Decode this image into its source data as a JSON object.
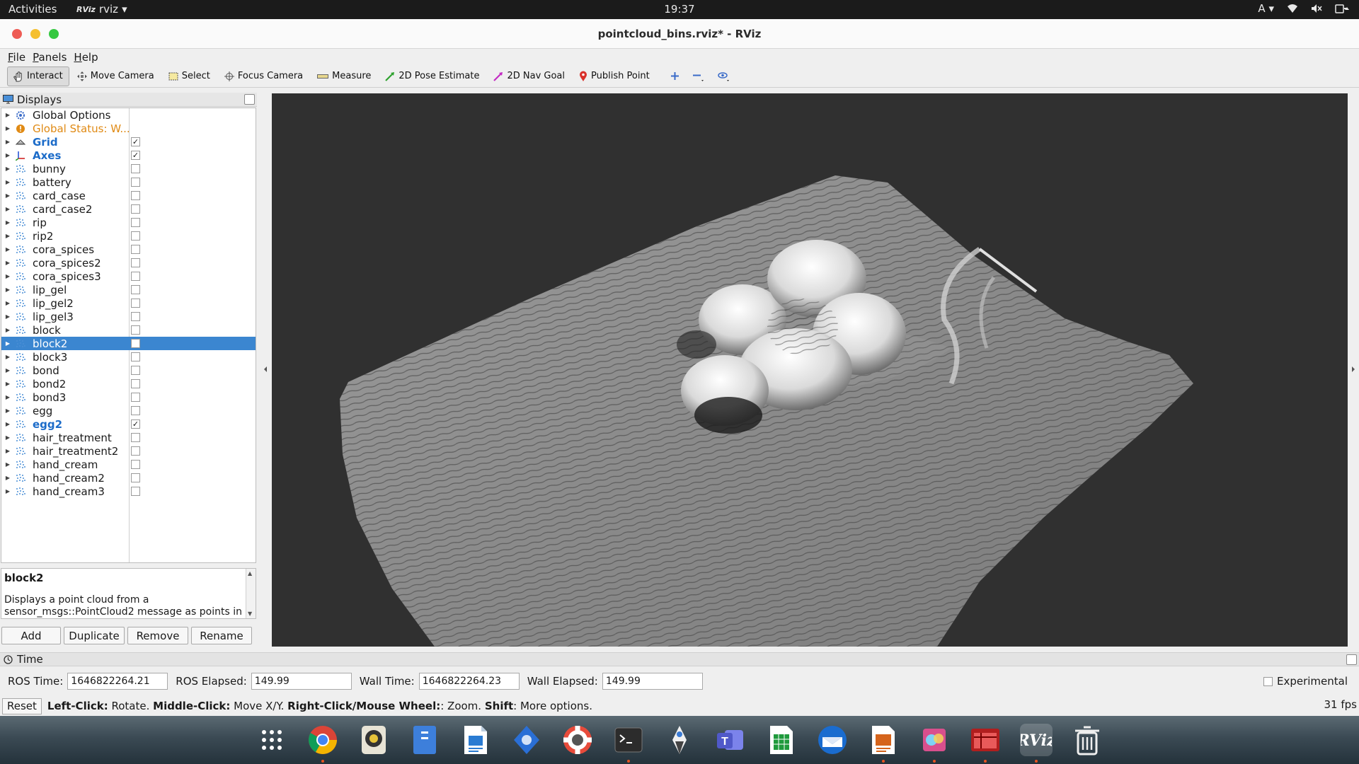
{
  "topbar": {
    "activities": "Activities",
    "app_name": "rviz",
    "app_logo": "RViz",
    "clock": "19:37",
    "input_lang": "A"
  },
  "window": {
    "title": "pointcloud_bins.rviz* - RViz"
  },
  "menu": [
    "File",
    "Panels",
    "Help"
  ],
  "toolbar": {
    "interact": "Interact",
    "move_camera": "Move Camera",
    "select": "Select",
    "focus_camera": "Focus Camera",
    "measure": "Measure",
    "pose_estimate": "2D Pose Estimate",
    "nav_goal": "2D Nav Goal",
    "publish_point": "Publish Point"
  },
  "displays": {
    "title": "Displays",
    "items": [
      {
        "label": "Global Options",
        "icon": "gear-icon",
        "style": "normal",
        "check": null
      },
      {
        "label": "Global Status: W...",
        "icon": "warning-icon",
        "style": "warn",
        "check": null
      },
      {
        "label": "Grid",
        "icon": "grid-icon",
        "style": "bold",
        "check": true
      },
      {
        "label": "Axes",
        "icon": "axes-icon",
        "style": "bold",
        "check": true
      },
      {
        "label": "bunny",
        "icon": "pointcloud-icon",
        "style": "normal",
        "check": false
      },
      {
        "label": "battery",
        "icon": "pointcloud-icon",
        "style": "normal",
        "check": false
      },
      {
        "label": "card_case",
        "icon": "pointcloud-icon",
        "style": "normal",
        "check": false
      },
      {
        "label": "card_case2",
        "icon": "pointcloud-icon",
        "style": "normal",
        "check": false
      },
      {
        "label": "rip",
        "icon": "pointcloud-icon",
        "style": "normal",
        "check": false
      },
      {
        "label": "rip2",
        "icon": "pointcloud-icon",
        "style": "normal",
        "check": false
      },
      {
        "label": "cora_spices",
        "icon": "pointcloud-icon",
        "style": "normal",
        "check": false
      },
      {
        "label": "cora_spices2",
        "icon": "pointcloud-icon",
        "style": "normal",
        "check": false
      },
      {
        "label": "cora_spices3",
        "icon": "pointcloud-icon",
        "style": "normal",
        "check": false
      },
      {
        "label": "lip_gel",
        "icon": "pointcloud-icon",
        "style": "normal",
        "check": false
      },
      {
        "label": "lip_gel2",
        "icon": "pointcloud-icon",
        "style": "normal",
        "check": false
      },
      {
        "label": "lip_gel3",
        "icon": "pointcloud-icon",
        "style": "normal",
        "check": false
      },
      {
        "label": "block",
        "icon": "pointcloud-icon",
        "style": "normal",
        "check": false
      },
      {
        "label": "block2",
        "icon": "pointcloud-icon",
        "style": "selected",
        "check": false
      },
      {
        "label": "block3",
        "icon": "pointcloud-icon",
        "style": "normal",
        "check": false
      },
      {
        "label": "bond",
        "icon": "pointcloud-icon",
        "style": "normal",
        "check": false
      },
      {
        "label": "bond2",
        "icon": "pointcloud-icon",
        "style": "normal",
        "check": false
      },
      {
        "label": "bond3",
        "icon": "pointcloud-icon",
        "style": "normal",
        "check": false
      },
      {
        "label": "egg",
        "icon": "pointcloud-icon",
        "style": "normal",
        "check": false
      },
      {
        "label": "egg2",
        "icon": "pointcloud-icon",
        "style": "bold",
        "check": true
      },
      {
        "label": "hair_treatment",
        "icon": "pointcloud-icon",
        "style": "normal",
        "check": false
      },
      {
        "label": "hair_treatment2",
        "icon": "pointcloud-icon",
        "style": "normal",
        "check": false
      },
      {
        "label": "hand_cream",
        "icon": "pointcloud-icon",
        "style": "normal",
        "check": false
      },
      {
        "label": "hand_cream2",
        "icon": "pointcloud-icon",
        "style": "normal",
        "check": false
      },
      {
        "label": "hand_cream3",
        "icon": "pointcloud-icon",
        "style": "normal",
        "check": false
      }
    ],
    "description_title": "block2",
    "description_text": "Displays a point cloud from a sensor_msgs::PointCloud2 message as points in",
    "buttons": {
      "add": "Add",
      "duplicate": "Duplicate",
      "remove": "Remove",
      "rename": "Rename"
    }
  },
  "time": {
    "title": "Time",
    "ros_time_label": "ROS Time:",
    "ros_time": "1646822264.21",
    "ros_elapsed_label": "ROS Elapsed:",
    "ros_elapsed": "149.99",
    "wall_time_label": "Wall Time:",
    "wall_time": "1646822264.23",
    "wall_elapsed_label": "Wall Elapsed:",
    "wall_elapsed": "149.99",
    "experimental": "Experimental"
  },
  "status": {
    "reset": "Reset",
    "hint_parts": [
      {
        "b": "Left-Click:",
        "t": " Rotate. "
      },
      {
        "b": "Middle-Click:",
        "t": " Move X/Y. "
      },
      {
        "b": "Right-Click/Mouse Wheel:",
        "t": ": Zoom. "
      },
      {
        "b": "Shift",
        "t": ": More options."
      }
    ],
    "fps": "31 fps"
  },
  "dock": [
    {
      "name": "app-grid-icon",
      "running": false
    },
    {
      "name": "chrome-icon",
      "running": true
    },
    {
      "name": "rhythmbox-icon",
      "running": false
    },
    {
      "name": "files-icon",
      "running": false
    },
    {
      "name": "writer-icon",
      "running": false
    },
    {
      "name": "software-icon",
      "running": false
    },
    {
      "name": "help-icon",
      "running": false
    },
    {
      "name": "terminal-icon",
      "running": true
    },
    {
      "name": "inkscape-icon",
      "running": false
    },
    {
      "name": "teams-icon",
      "running": false
    },
    {
      "name": "calc-icon",
      "running": false
    },
    {
      "name": "thunderbird-icon",
      "running": false
    },
    {
      "name": "impress-icon",
      "running": true
    },
    {
      "name": "shotwell-icon",
      "running": true
    },
    {
      "name": "rqt-icon",
      "running": true
    },
    {
      "name": "rviz-icon",
      "running": true
    },
    {
      "name": "trash-icon",
      "running": false
    }
  ],
  "colors": {
    "accent": "#3b86d0",
    "enabled_label": "#1c6cc9",
    "warning": "#e08a14",
    "ubuntu_orange": "#e95420"
  }
}
